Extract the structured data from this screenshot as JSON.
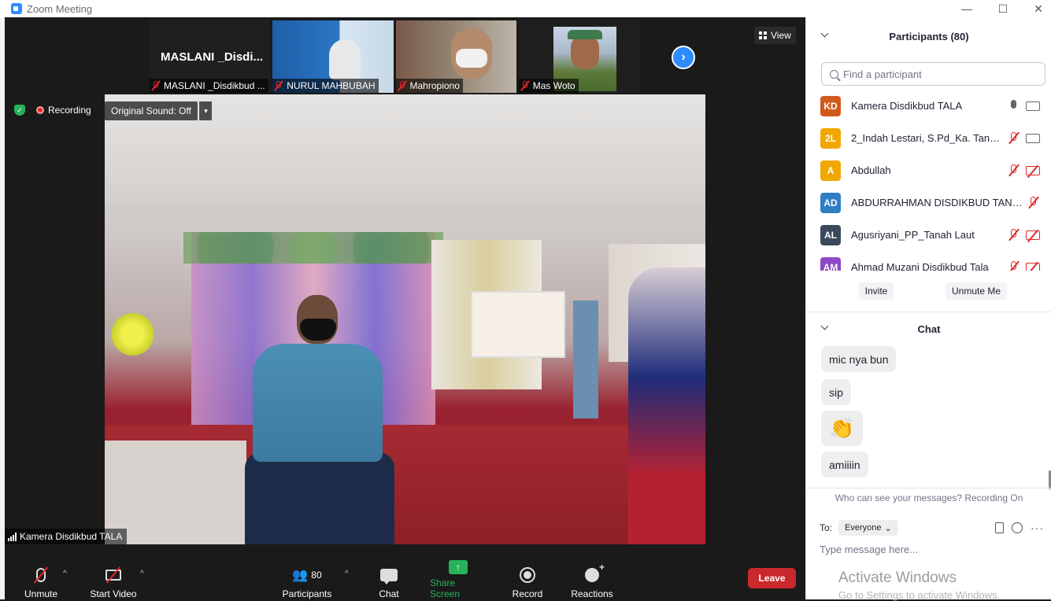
{
  "window": {
    "title": "Zoom Meeting",
    "minimize": "—",
    "maximize": "☐",
    "close": "✕"
  },
  "thumbnails": [
    {
      "name_large": "MASLANI _Disdi...",
      "label": "MASLANI _Disdikbud ...",
      "muted": true
    },
    {
      "label": "NURUL MAHBUBAH",
      "muted": true
    },
    {
      "label": "Mahropiono",
      "muted": true
    },
    {
      "label": "Mas Woto",
      "muted": true
    }
  ],
  "view_button": "View",
  "next_arrow": "›",
  "recording": {
    "shield_glyph": "✓",
    "label": "Recording",
    "original_sound": "Original Sound: Off",
    "caret": "▾"
  },
  "speaker": {
    "name": "Kamera Disdikbud TALA"
  },
  "toolbar": {
    "unmute": "Unmute",
    "start_video": "Start Video",
    "participants": "Participants",
    "participants_count": "80",
    "chat": "Chat",
    "share_screen": "Share Screen",
    "share_glyph": "↑",
    "record": "Record",
    "reactions": "Reactions",
    "caret": "^",
    "leave": "Leave"
  },
  "panel": {
    "participants_title": "Participants (80)",
    "search_placeholder": "Find a participant",
    "participants": [
      {
        "initials": "KD",
        "name": "Kamera Disdikbud TALA",
        "color": "#d05a1c",
        "mic": "on",
        "cam": "on"
      },
      {
        "initials": "2L",
        "name": "2_Indah Lestari, S.Pd_Ka. Tanah ...",
        "color": "#f0a800",
        "mic": "off",
        "cam": "on"
      },
      {
        "initials": "A",
        "name": "Abdullah",
        "color": "#f0a800",
        "mic": "off",
        "cam": "off"
      },
      {
        "initials": "AD",
        "name": "ABDURRAHMAN DISDIKBUD TANAH...",
        "color": "#2e7fc4",
        "mic": "off",
        "cam": "none"
      },
      {
        "initials": "AL",
        "name": "Agusriyani_PP_Tanah Laut",
        "color": "#3a4a5c",
        "mic": "off",
        "cam": "off"
      },
      {
        "initials": "AM",
        "name": "Ahmad Muzani Disdikbud Tala",
        "color": "#8e4ac4",
        "mic": "off",
        "cam": "off"
      }
    ],
    "invite": "Invite",
    "unmute_me": "Unmute Me",
    "chat_title": "Chat",
    "messages": [
      {
        "text": "mic nya bun"
      },
      {
        "text": "sip"
      },
      {
        "text": "👏"
      },
      {
        "text": "amiiiin"
      }
    ],
    "who_can_see": "Who can see your messages? Recording On",
    "to_label": "To:",
    "to_value": "Everyone",
    "to_caret": "⌄",
    "more": "···",
    "message_placeholder": "Type message here...",
    "activate_title": "Activate Windows",
    "activate_sub": "Go to Settings to activate Windows."
  }
}
